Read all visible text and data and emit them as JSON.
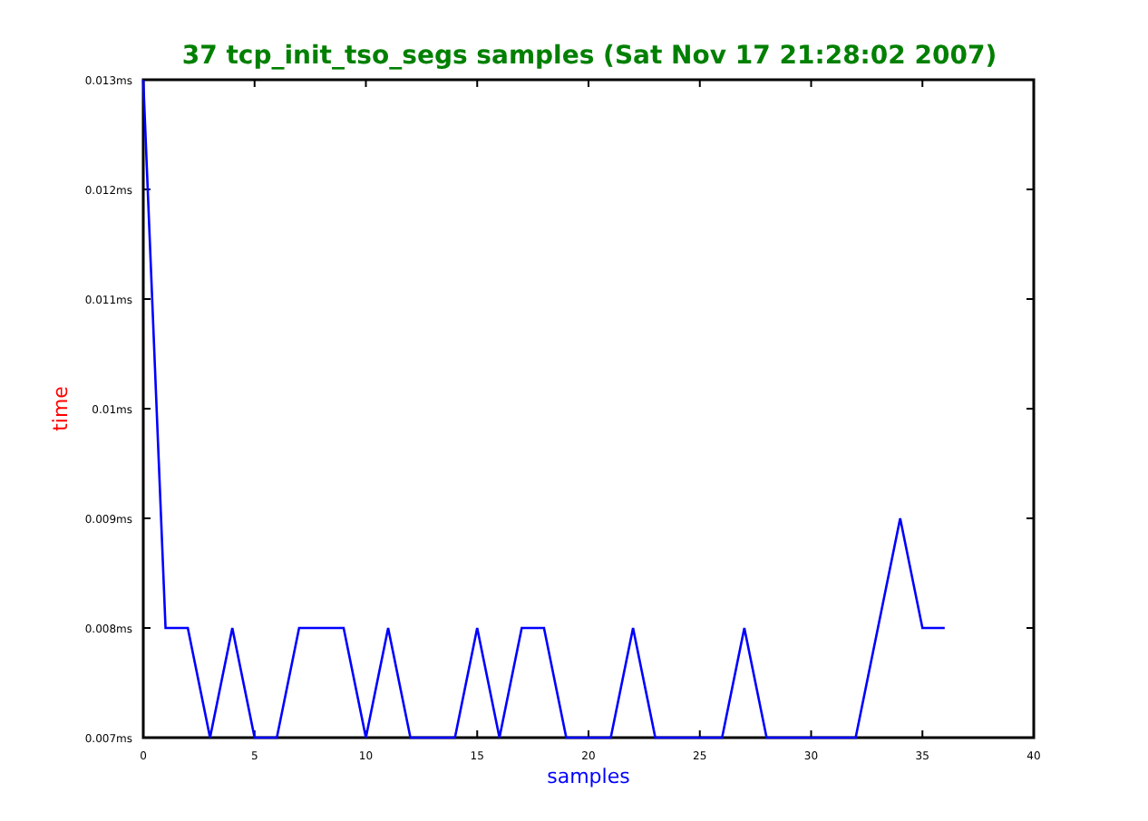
{
  "chart_data": {
    "type": "line",
    "title": "37 tcp_init_tso_segs samples (Sat Nov 17 21:28:02 2007)",
    "xlabel": "samples",
    "ylabel": "time",
    "x": [
      0,
      1,
      2,
      3,
      4,
      5,
      6,
      7,
      8,
      9,
      10,
      11,
      12,
      13,
      14,
      15,
      16,
      17,
      18,
      19,
      20,
      21,
      22,
      23,
      24,
      25,
      26,
      27,
      28,
      29,
      30,
      31,
      32,
      33,
      34,
      35,
      36
    ],
    "series": [
      {
        "color": "#0000ff",
        "values": [
          0.013,
          0.008,
          0.008,
          0.007,
          0.008,
          0.007,
          0.007,
          0.008,
          0.008,
          0.008,
          0.007,
          0.008,
          0.007,
          0.007,
          0.007,
          0.008,
          0.007,
          0.008,
          0.008,
          0.007,
          0.007,
          0.007,
          0.008,
          0.007,
          0.007,
          0.007,
          0.007,
          0.008,
          0.007,
          0.007,
          0.007,
          0.007,
          0.007,
          0.008,
          0.009,
          0.008,
          0.008
        ]
      }
    ],
    "xlim": [
      0,
      40
    ],
    "ylim": [
      0.007,
      0.013
    ],
    "xticks": [
      0,
      5,
      10,
      15,
      20,
      25,
      30,
      35,
      40
    ],
    "yticks": [
      {
        "value": 0.007,
        "label": "0.007ms"
      },
      {
        "value": 0.008,
        "label": "0.008ms"
      },
      {
        "value": 0.009,
        "label": "0.009ms"
      },
      {
        "value": 0.01,
        "label": "0.01ms"
      },
      {
        "value": 0.011,
        "label": "0.011ms"
      },
      {
        "value": 0.012,
        "label": "0.012ms"
      },
      {
        "value": 0.013,
        "label": "0.013ms"
      }
    ]
  }
}
